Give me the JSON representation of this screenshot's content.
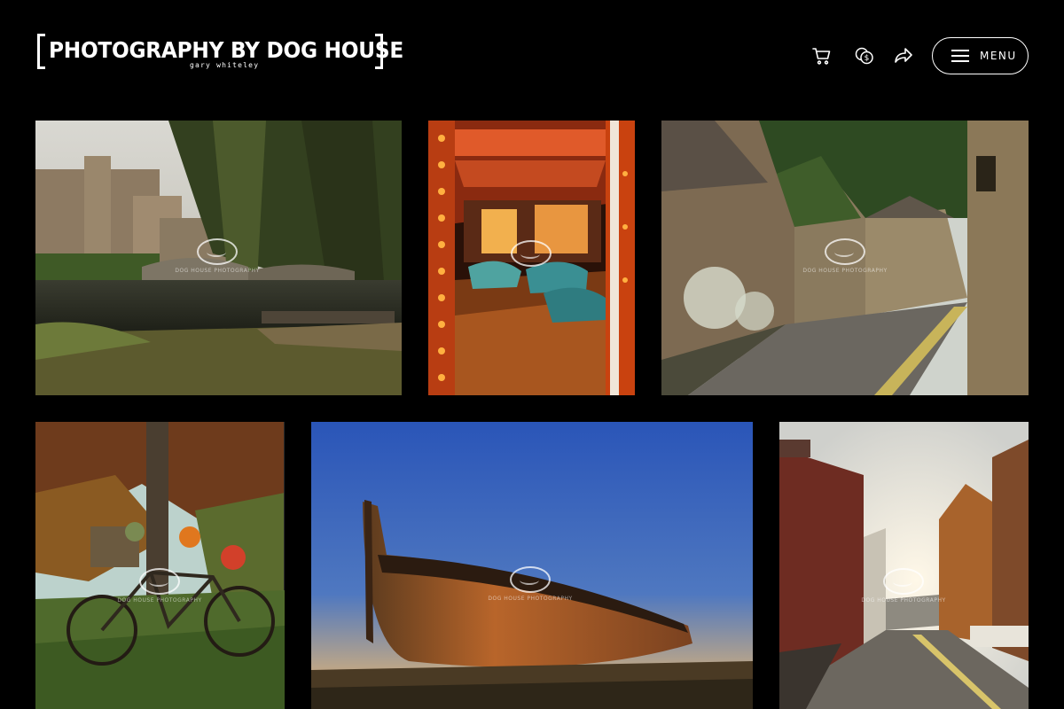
{
  "header": {
    "logo_title": "[PHOTOGRAPHY BY DOG HOUSE]",
    "logo_subtitle": "gary whiteley",
    "icons": [
      "cart-icon",
      "currency-icon",
      "share-icon"
    ],
    "menu_label": "MENU"
  },
  "watermark_text": "DOG HOUSE PHOTOGRAPHY",
  "gallery": {
    "photos": [
      {
        "subject": "willow tree over river with stone bridge and castle"
      },
      {
        "subject": "fairground dodgem cars ride"
      },
      {
        "subject": "ivy covered village cottages street"
      },
      {
        "subject": "bicycle with pumpkins under autumn tree"
      },
      {
        "subject": "wooden boat wreck at sunset"
      },
      {
        "subject": "sunlit village street with red brick houses"
      }
    ]
  },
  "colors": {
    "background": "#000000",
    "foreground": "#ffffff"
  }
}
